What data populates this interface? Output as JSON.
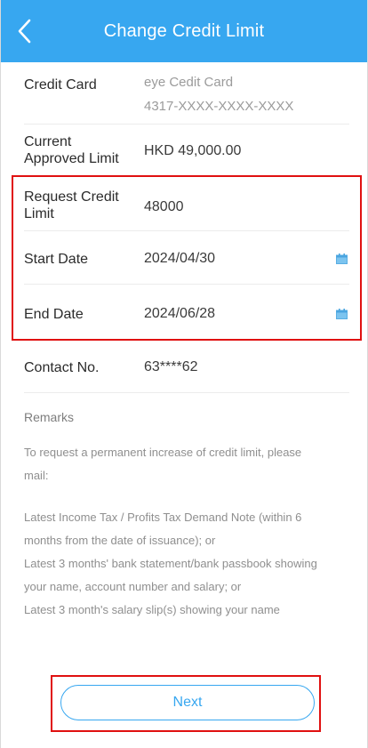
{
  "header": {
    "title": "Change Credit Limit"
  },
  "form": {
    "credit_card": {
      "label": "Credit Card",
      "card_name": "eye Cedit Card",
      "card_number": "4317-XXXX-XXXX-XXXX"
    },
    "current_limit": {
      "label_line1": "Current",
      "label_line2": "Approved Limit",
      "value": "HKD 49,000.00"
    },
    "request_limit": {
      "label_line1": "Request Credit",
      "label_line2": "Limit",
      "value": "48000"
    },
    "start_date": {
      "label": "Start Date",
      "value": "2024/04/30"
    },
    "end_date": {
      "label": "End Date",
      "value": "2024/06/28"
    },
    "contact": {
      "label": "Contact No.",
      "value": "63****62"
    }
  },
  "remarks": {
    "title": "Remarks",
    "intro_line1": "To request a permanent increase of credit limit, please",
    "intro_line2": "mail:",
    "item1_line1": "Latest Income Tax / Profits Tax Demand Note (within 6",
    "item1_line2": "months from the date of issuance); or",
    "item2_line1": "Latest 3 months' bank statement/bank passbook showing",
    "item2_line2": "your name, account number and salary; or",
    "item3": "Latest 3 month's salary slip(s) showing your name"
  },
  "footer": {
    "next_label": "Next"
  },
  "colors": {
    "brand": "#37a7f0",
    "highlight": "#e01010"
  }
}
